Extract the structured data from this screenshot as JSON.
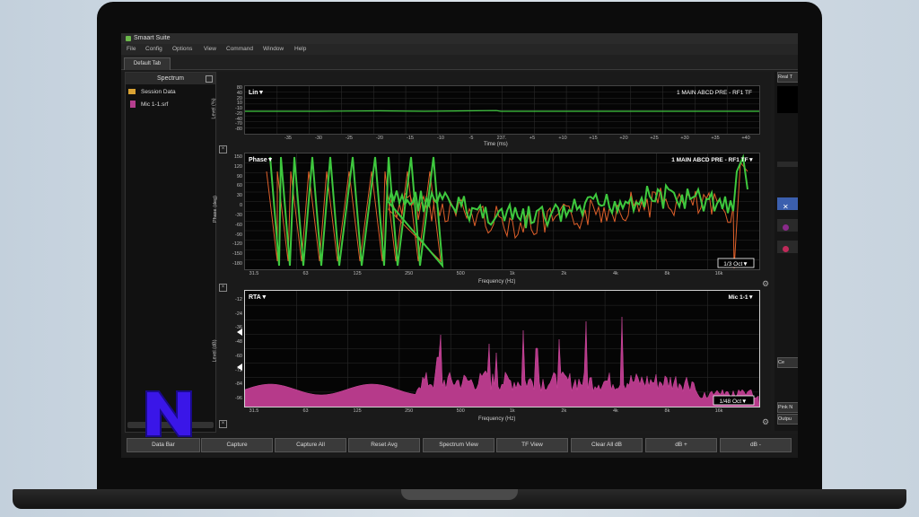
{
  "app": {
    "title": "Smaart Suite",
    "menu": [
      "File",
      "Config",
      "Options",
      "View",
      "Command",
      "Window",
      "Help"
    ],
    "tab": "Default Tab"
  },
  "sidebar": {
    "header": "Spectrum",
    "items": [
      {
        "label": "Session Data",
        "icon": "folder-icon"
      },
      {
        "label": "Mic 1-1.srf",
        "icon": "file-icon"
      }
    ]
  },
  "right_panel": {
    "buttons": [
      "Real T",
      "Ce",
      "Pink N",
      "Outpu"
    ]
  },
  "colors": {
    "green_trace": "#3ec83e",
    "orange_trace": "#e0602a",
    "rta_fill": "#b63a8a",
    "folder": "#d9a233",
    "logo": "#3a16e8"
  },
  "charts": {
    "impulse": {
      "mode": "Lin▼",
      "title": "1 MAIN ABCD PRE - RF1 TF",
      "ylabel": "Level (%)",
      "xlabel": "Time (ms)",
      "yticks": [
        "80",
        "40",
        "20",
        "10",
        "-10",
        "-20",
        "-40",
        "-70",
        "-80"
      ],
      "xticks": [
        "-35",
        "-30",
        "-25",
        "-20",
        "-15",
        "-10",
        "-5",
        "237.",
        "+5",
        "+10",
        "+15",
        "+20",
        "+25",
        "+30",
        "+35",
        "+40"
      ]
    },
    "phase": {
      "mode": "Phase▼",
      "title": "1 MAIN ABCD PRE - RF1 TF▼",
      "ylabel": "Phase (deg)",
      "xlabel": "Frequency (Hz)",
      "yticks": [
        "150",
        "120",
        "90",
        "60",
        "30",
        "0",
        "-30",
        "-60",
        "-90",
        "-120",
        "-150",
        "-180"
      ],
      "xticks": [
        "31.5",
        "63",
        "125",
        "250",
        "500",
        "1k",
        "2k",
        "4k",
        "8k",
        "16k"
      ],
      "smoothing": "1/3 Oct▼"
    },
    "rta": {
      "mode": "RTA▼",
      "title": "Mic 1-1▼",
      "ylabel": "Level (dB)",
      "xlabel": "Frequency (Hz)",
      "yticks": [
        "-12",
        "-24",
        "-36",
        "-48",
        "-60",
        "-72",
        "-84",
        "-96"
      ],
      "xticks": [
        "31.5",
        "63",
        "125",
        "250",
        "500",
        "1k",
        "2k",
        "4k",
        "8k",
        "16k"
      ],
      "smoothing": "1/48 Oct▼"
    }
  },
  "bottom_buttons": [
    "Data Bar",
    "Capture",
    "Capture All",
    "Reset Avg",
    "Spectrum View",
    "TF View",
    "Clear All dB",
    "dB +",
    "dB -"
  ]
}
